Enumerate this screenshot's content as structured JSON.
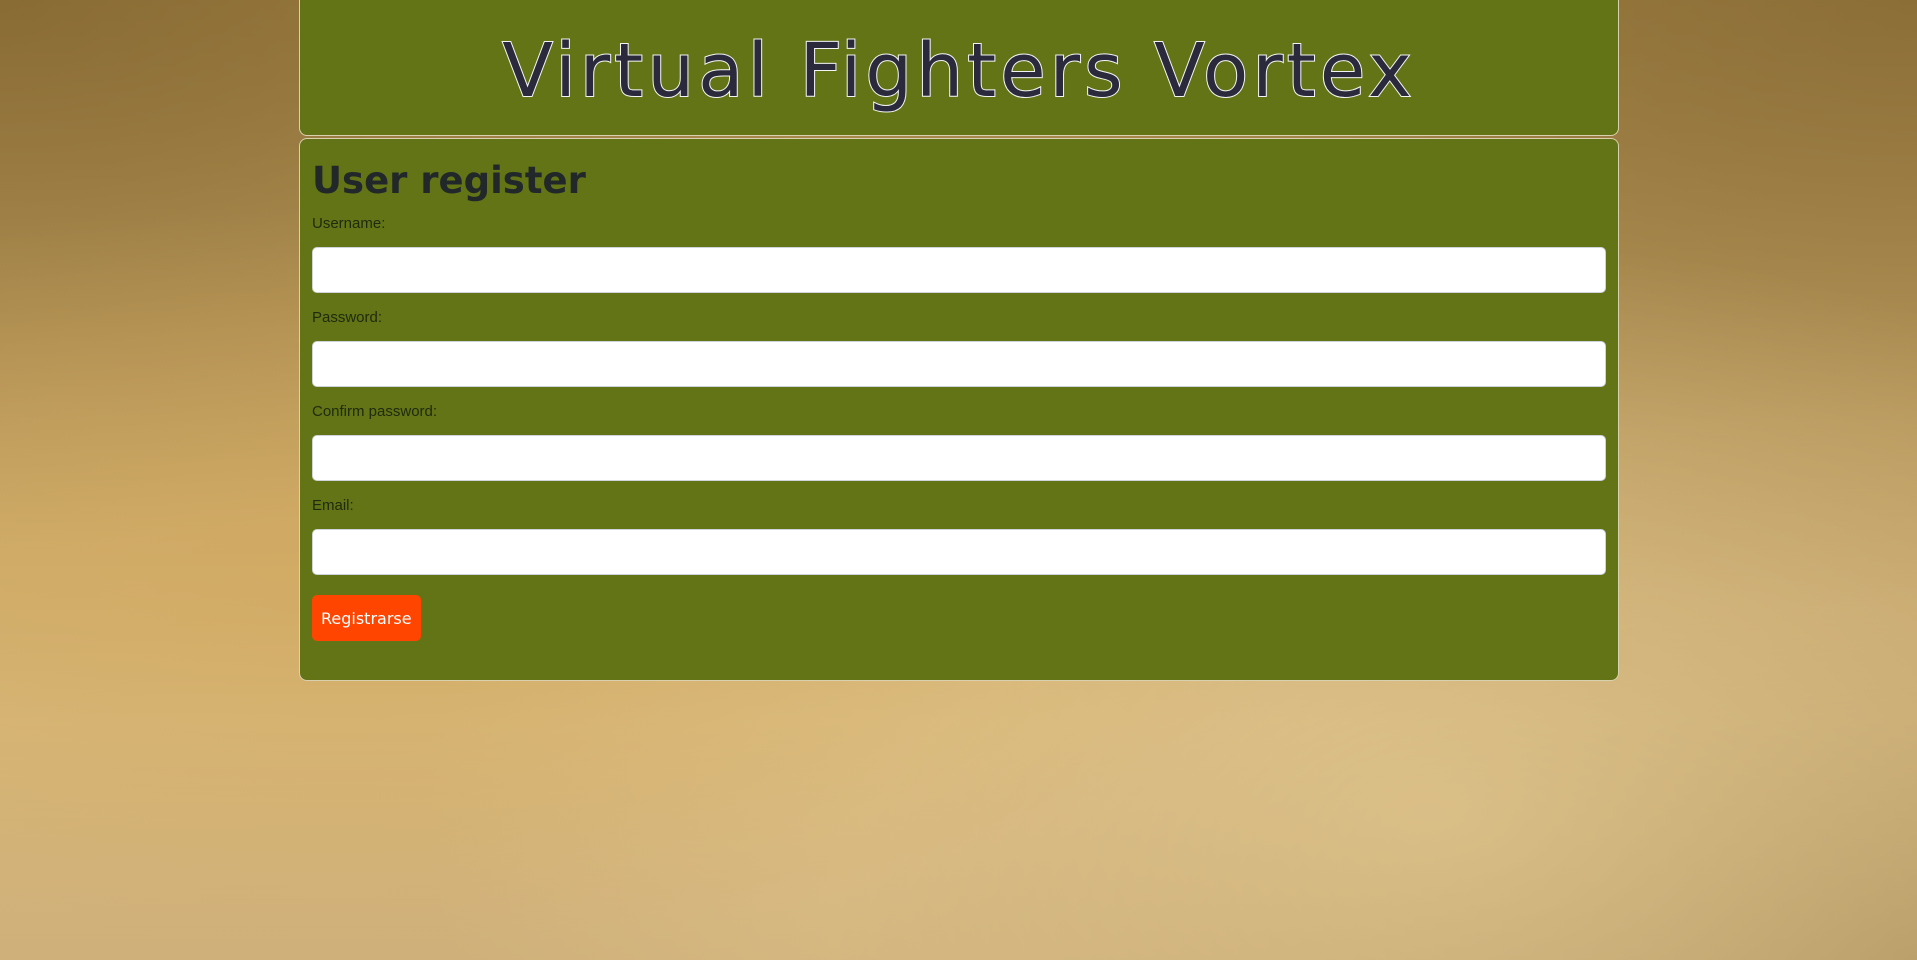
{
  "header": {
    "site_title": "Virtual Fighters Vortex"
  },
  "form": {
    "title": "User register",
    "fields": [
      {
        "label": "Username:",
        "value": "",
        "placeholder": ""
      },
      {
        "label": "Password:",
        "value": "",
        "placeholder": ""
      },
      {
        "label": "Confirm password:",
        "value": "",
        "placeholder": ""
      },
      {
        "label": "Email:",
        "value": "",
        "placeholder": ""
      }
    ],
    "submit_label": "Registrarse"
  },
  "colors": {
    "card_background": "#627415",
    "button_background": "#ff4500",
    "title_text": "#2a2a3c"
  }
}
